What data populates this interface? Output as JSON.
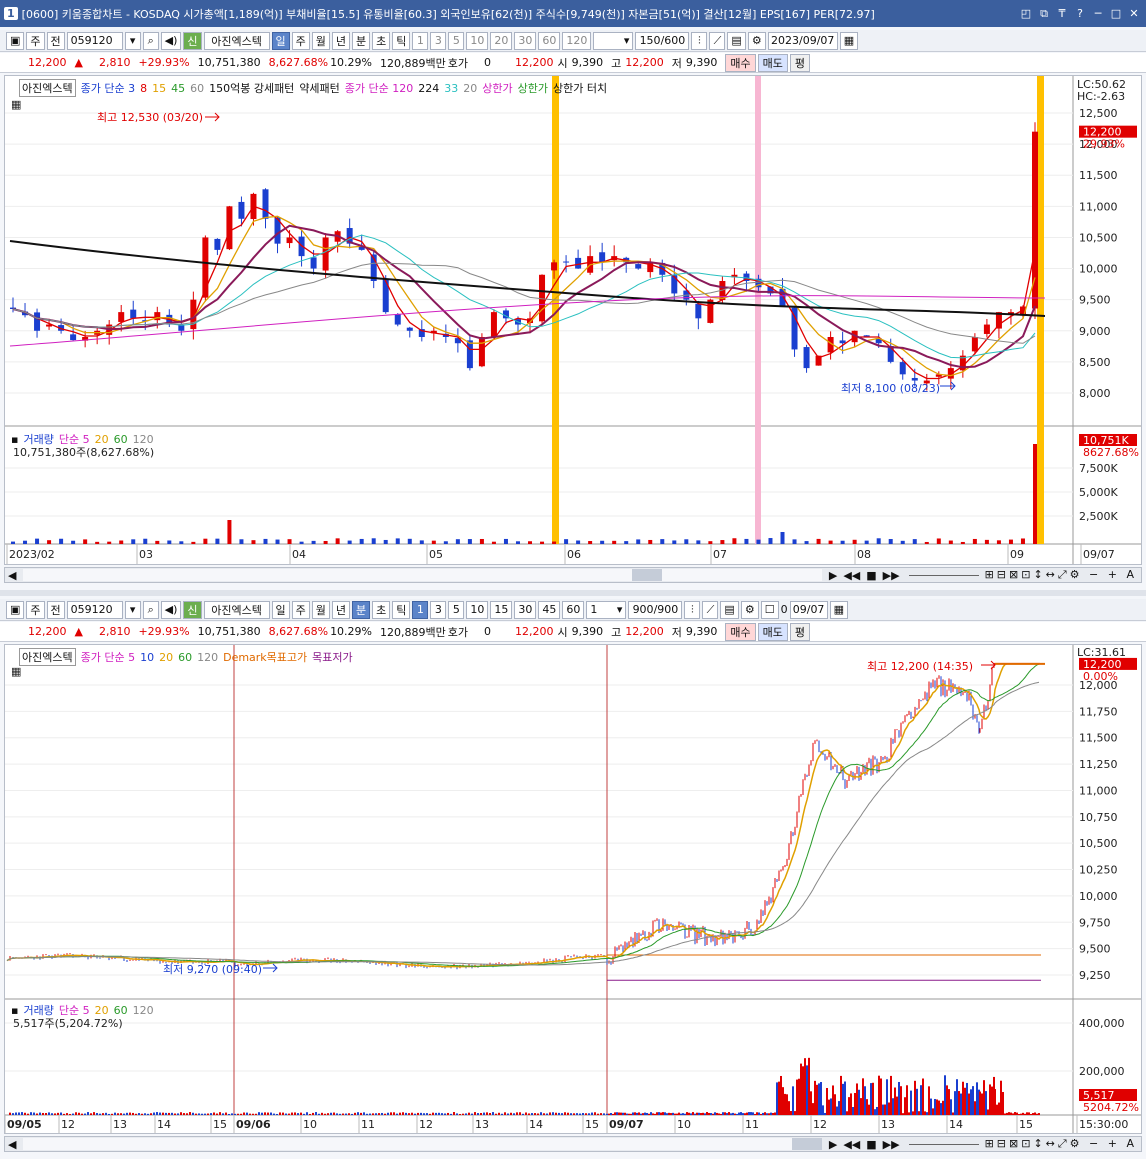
{
  "window": {
    "num": "1",
    "title": "[0600] 키움종합차트 - KOSDAQ 시가총액[1,189(억)] 부채비율[15.5] 유통비율[60.3] 외국인보유[62(천)] 주식수[9,749(천)] 자본금[51(억)] 결산[12월] EPS[167] PER[72.97]",
    "controls": [
      "◰",
      "⧉",
      "₸",
      "?",
      "─",
      "□",
      "✕"
    ]
  },
  "top_pane": {
    "toolbar": {
      "period_type": "주",
      "jeon": "전",
      "code": "059120",
      "sin": "신",
      "name": "아진엑스텍",
      "period_tabs": [
        "일",
        "주",
        "월",
        "년",
        "분",
        "초",
        "틱"
      ],
      "selected_period": "일",
      "intervals": [
        "1",
        "3",
        "5",
        "10",
        "20",
        "30",
        "60",
        "120"
      ],
      "count": "150",
      "count_total": "/600",
      "date": "2023/09/07"
    },
    "quote": {
      "price": "12,200",
      "arrow": "▲",
      "change": "2,810",
      "change_pct": "+29.93%",
      "volume": "10,751,380",
      "vol_ratio": "8,627.68%",
      "turnover": "10.29%",
      "amount": "120,889백만",
      "hoga_label": "호가",
      "hoga": "0",
      "last": "12,200",
      "open_label": "시",
      "open": "9,390",
      "high_label": "고",
      "high": "12,200",
      "low_label": "저",
      "low": "9,390",
      "buy": "매수",
      "sell": "매도",
      "avg": "평"
    },
    "price_legend": [
      "아진엑스텍",
      "종가 단순 3",
      "8",
      "15",
      "45",
      "60",
      "150억봉 강세패턴",
      "약세패턴",
      "종가 단순 120",
      "224",
      "33",
      "20",
      "상한가",
      "상한가",
      "상한가 터치"
    ],
    "lc": "LC:50.62",
    "hc": "HC:-2.63",
    "price_ticks": [
      "12,500",
      "12,000",
      "11,500",
      "11,000",
      "10,500",
      "10,000",
      "9,500",
      "9,000",
      "8,500",
      "8,000"
    ],
    "last_price_tag": "12,200",
    "last_pct_tag": "29.93%",
    "high_note": "최고 12,530 (03/20)",
    "low_note": "최저 8,100 (08/23)",
    "volume_legend": [
      "거래량",
      "단순 5",
      "20",
      "60",
      "120"
    ],
    "volume_value": "10,751,380주(8,627.68%)",
    "volume_ticks": [
      "7,500K",
      "5,000K",
      "2,500K"
    ],
    "vol_tag": "10,751K",
    "vol_pct_tag": "8627.68%",
    "x_labels": [
      "2023/02",
      "03",
      "04",
      "05",
      "06",
      "07",
      "08",
      "09",
      "09/07"
    ],
    "colors": {
      "up": "#e00000",
      "down": "#1a3fd0",
      "limit": "#ffc000",
      "pink": "#f7b6d2"
    }
  },
  "bottom_pane": {
    "toolbar": {
      "period_type": "주",
      "jeon": "전",
      "code": "059120",
      "sin": "신",
      "name": "아진엑스텍",
      "period_tabs": [
        "일",
        "주",
        "월",
        "년",
        "분",
        "초",
        "틱"
      ],
      "selected_period": "분",
      "intervals": [
        "1",
        "3",
        "5",
        "10",
        "15",
        "30",
        "45",
        "60"
      ],
      "selected_interval": "1",
      "spin": "1",
      "count": "900",
      "count_total": "/900",
      "check_label": "0",
      "date": "09/07"
    },
    "quote": {
      "price": "12,200",
      "arrow": "▲",
      "change": "2,810",
      "change_pct": "+29.93%",
      "volume": "10,751,380",
      "vol_ratio": "8,627.68%",
      "turnover": "10.29%",
      "amount": "120,889백만",
      "hoga_label": "호가",
      "hoga": "0",
      "last": "12,200",
      "open_label": "시",
      "open": "9,390",
      "high_label": "고",
      "high": "12,200",
      "low_label": "저",
      "low": "9,390",
      "buy": "매수",
      "sell": "매도",
      "avg": "평"
    },
    "price_legend": [
      "아진엑스텍",
      "종가 단순 5",
      "10",
      "20",
      "60",
      "120",
      "Demark목표고가",
      "목표저가"
    ],
    "lc": "LC:31.61",
    "price_ticks": [
      "12,000",
      "11,750",
      "11,500",
      "11,250",
      "11,000",
      "10,750",
      "10,500",
      "10,250",
      "10,000",
      "9,750",
      "9,500",
      "9,250"
    ],
    "last_price_tag": "12,200",
    "last_pct_tag": "0.00%",
    "high_note": "최고 12,200 (14:35)",
    "low_note": "최저 9,270 (09:40)",
    "volume_legend": [
      "거래량",
      "단순 5",
      "20",
      "60",
      "120"
    ],
    "volume_value": "5,517주(5,204.72%)",
    "volume_ticks": [
      "400,000",
      "200,000"
    ],
    "vol_tag": "5,517",
    "vol_pct_tag": "5204.72%",
    "x_labels": [
      "09/05",
      "12",
      "13",
      "14",
      "15",
      "09/06",
      "10",
      "11",
      "12",
      "13",
      "14",
      "15",
      "09/07",
      "10",
      "11",
      "12",
      "13",
      "14",
      "15",
      "15:30:00"
    ]
  },
  "scroll_controls": [
    "▶",
    "◀◀",
    "■",
    "▶▶"
  ],
  "right_tools": [
    "⊞",
    "⊟",
    "⊠",
    "⊡",
    "↕",
    "↔",
    "⤢",
    "⚙",
    "−",
    "+",
    "A"
  ]
}
